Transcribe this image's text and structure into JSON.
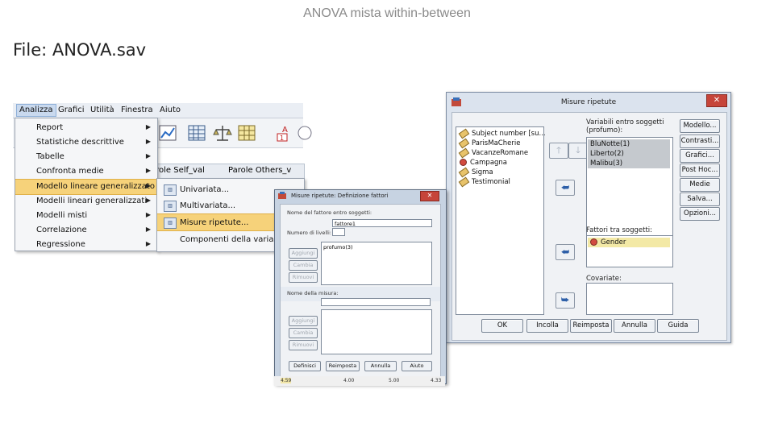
{
  "slide": {
    "title": "ANOVA mista within-between",
    "file_label": "File: ANOVA.sav"
  },
  "spss": {
    "menubar": [
      "Analizza",
      "Grafici",
      "Utilità",
      "Finestra",
      "Aiuto"
    ],
    "column_headers": [
      "arole Self_val",
      "Parole Others_v"
    ],
    "analyze_menu": [
      {
        "label": "Report",
        "submenu": true
      },
      {
        "label": "Statistiche descrittive",
        "submenu": true
      },
      {
        "label": "Tabelle",
        "submenu": true
      },
      {
        "label": "Confronta medie",
        "submenu": true
      },
      {
        "label": "Modello lineare generalizzato",
        "submenu": true,
        "highlighted": true
      },
      {
        "label": "Modelli lineari generalizzati",
        "submenu": true
      },
      {
        "label": "Modelli misti",
        "submenu": true
      },
      {
        "label": "Correlazione",
        "submenu": true
      },
      {
        "label": "Regressione",
        "submenu": true
      }
    ],
    "glm_submenu": [
      {
        "label": "Univariata...",
        "icon": "univariate-icon"
      },
      {
        "label": "Multivariata...",
        "icon": "multivariate-icon"
      },
      {
        "label": "Misure ripetute...",
        "icon": "repeated-measures-icon",
        "highlighted": true
      },
      {
        "label": "Componenti della varianza...",
        "icon": ""
      }
    ]
  },
  "dialog_main": {
    "title": "Misure ripetute",
    "close": "✕",
    "variables": [
      {
        "label": "Subject number [su...",
        "icon": "scale-icon"
      },
      {
        "label": "ParisMaCherie",
        "icon": "scale-icon"
      },
      {
        "label": "VacanzeRomane",
        "icon": "scale-icon"
      },
      {
        "label": "Campagna",
        "icon": "nominal-icon"
      },
      {
        "label": "Sigma",
        "icon": "scale-icon"
      },
      {
        "label": "Testimonial",
        "icon": "scale-icon"
      }
    ],
    "within_label": "Variabili entro soggetti\n(profumo):",
    "within_items": [
      "BluNotte(1)",
      "Liberto(2)",
      "Malibu(3)"
    ],
    "between_label": "Fattori tra soggetti:",
    "between_items": [
      "Gender"
    ],
    "covariates_label": "Covariate:",
    "side_buttons": [
      "Modello...",
      "Contrasti...",
      "Grafici...",
      "Post Hoc...",
      "Medie EM...",
      "Salva...",
      "Opzioni..."
    ],
    "bottom_buttons": [
      "OK",
      "Incolla",
      "Reimposta",
      "Annulla",
      "Guida"
    ]
  },
  "dialog_factor": {
    "title": "Misure ripetute: Definizione fattori",
    "close": "✕",
    "factor_name_label": "Nome del fattore entro soggetti:",
    "factor_name_value": "fattore1",
    "levels_label": "Numero di livelli:",
    "levels_value": "",
    "factor_list": [
      "profumo(3)"
    ],
    "factor_buttons": [
      "Aggiungi",
      "Cambia",
      "Rimuovi"
    ],
    "measure_name_label": "Nome della misura:",
    "measure_buttons": [
      "Aggiungi",
      "Cambia",
      "Rimuovi"
    ],
    "bottom_buttons": [
      "Definisci",
      "Reimposta",
      "Annulla",
      "Aiuto"
    ],
    "strip_values": [
      "4.59",
      "4.00",
      "5.00",
      "4.33"
    ]
  }
}
